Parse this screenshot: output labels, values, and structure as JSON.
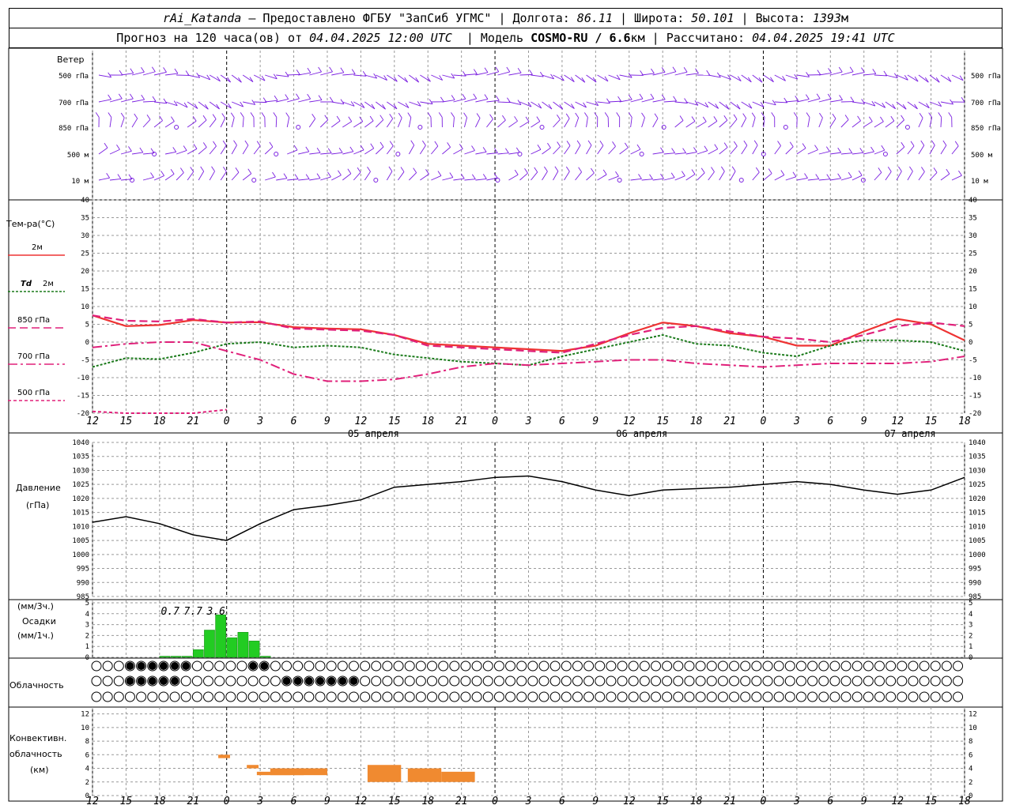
{
  "header": {
    "station": "rAi_Katanda",
    "provider": "— Предоставлено ФГБУ \"ЗапСиб УГМС\"",
    "lon_label": "Долгота:",
    "lon": "86.11",
    "lat_label": "Широта:",
    "lat": "50.101",
    "alt_label": "Высота:",
    "alt": "1393",
    "alt_unit": "м",
    "forecast_prefix": "Прогноз на 120 часа(ов) от",
    "forecast_start": "04.04.2025 12:00 UTC",
    "model_label": "Модель",
    "model": "COSMO-RU / 6.6",
    "model_unit": "км",
    "calc_label": "Рассчитано:",
    "calc_time": "04.04.2025 19:41 UTC"
  },
  "axis": {
    "hours": [
      "12",
      "15",
      "18",
      "21",
      "0",
      "3",
      "6",
      "9",
      "12",
      "15",
      "18",
      "21",
      "0",
      "3",
      "6",
      "9",
      "12",
      "15",
      "18",
      "21",
      "0",
      "3",
      "6",
      "9",
      "12",
      "15",
      "18"
    ],
    "dates": [
      "05 апреля",
      "06 апреля",
      "07 апреля"
    ]
  },
  "labels": {
    "wind": "Ветер",
    "levels": [
      "500 гПа",
      "700 гПа",
      "850 гПа",
      "500 м",
      "10 м"
    ],
    "temp_title": "Тем-ра(°C)",
    "t2m": "2м",
    "td_sym": "Td",
    "td2m": "2м",
    "t850": "850 гПа",
    "t700": "700 гПа",
    "t500": "500 гПа",
    "pressure": "Давление",
    "pressure_unit": "(гПа)",
    "precip_u1": "(мм/3ч.)",
    "precip": "Осадки",
    "precip_u2": "(мм/1ч.)",
    "cloud": "Облачность",
    "conv1": "Конвективн.",
    "conv2": "облачность",
    "conv3": "(км)"
  },
  "colors": {
    "t2m": "#ee3333",
    "td": "#1a7a1a",
    "t850": "#e0207a",
    "wind": "#7a1ee0",
    "precip": "#22cc22",
    "conv": "#f08a30"
  },
  "chart_data": [
    {
      "type": "line",
      "title": "Тем-ра(°C)",
      "ylim": [
        -20,
        40
      ],
      "yticks": [
        -20,
        -15,
        -10,
        -5,
        0,
        5,
        10,
        15,
        20,
        25,
        30,
        35,
        40
      ],
      "x": [
        0,
        1,
        2,
        3,
        4,
        5,
        6,
        7,
        8,
        9,
        10,
        11,
        12,
        13,
        14,
        15,
        16,
        17,
        18,
        19,
        20,
        21,
        22,
        23,
        24,
        25,
        26
      ],
      "series": [
        {
          "name": "2м",
          "values": [
            7.5,
            4.5,
            4.8,
            6.2,
            5.5,
            5.6,
            4.2,
            3.8,
            3.6,
            2.0,
            -0.5,
            -1.0,
            -1.5,
            -2.0,
            -2.5,
            -1.0,
            2.5,
            5.5,
            4.5,
            2.5,
            1.5,
            -1.0,
            -1.0,
            3.0,
            6.5,
            5.0,
            0.5
          ]
        },
        {
          "name": "Td 2м",
          "values": [
            -7,
            -4.5,
            -4.8,
            -3,
            -0.5,
            0,
            -1.5,
            -1,
            -1.5,
            -3.5,
            -4.5,
            -5.5,
            -6,
            -6.5,
            -4,
            -2,
            0,
            2.0,
            -0.5,
            -1,
            -3,
            -4,
            -1,
            0.5,
            0.5,
            0,
            -2.5
          ]
        },
        {
          "name": "850 гПа",
          "values": [
            7.5,
            6.0,
            5.8,
            6.5,
            5.5,
            5.8,
            3.8,
            3.5,
            3.2,
            2.0,
            -1.0,
            -1.5,
            -2.0,
            -2.5,
            -3.0,
            -0.5,
            2.0,
            4.0,
            4.5,
            3.0,
            1.5,
            1.0,
            0.0,
            2.0,
            4.5,
            5.5,
            4.5
          ]
        },
        {
          "name": "700 гПа",
          "values": [
            -1.5,
            -0.5,
            0,
            0,
            -2.5,
            -5,
            -9,
            -11,
            -11,
            -10.5,
            -9,
            -7,
            -6,
            -6.5,
            -6,
            -5.5,
            -5,
            -5,
            -6,
            -6.5,
            -7,
            -6.5,
            -6,
            -6,
            -6,
            -5.5,
            -4
          ]
        },
        {
          "name": "500 гПа",
          "values": [
            -19.5,
            -20,
            -20,
            -20,
            -19
          ]
        }
      ]
    },
    {
      "type": "line",
      "title": "Давление",
      "ylabel": "(гПа)",
      "ylim": [
        985,
        1040
      ],
      "yticks": [
        985,
        990,
        995,
        1000,
        1005,
        1010,
        1015,
        1020,
        1025,
        1030,
        1035,
        1040
      ],
      "x": [
        0,
        1,
        2,
        3,
        4,
        5,
        6,
        7,
        8,
        9,
        10,
        11,
        12,
        13,
        14,
        15,
        16,
        17,
        18,
        19,
        20,
        21,
        22,
        23,
        24,
        25,
        26
      ],
      "values": [
        1011.5,
        1013.5,
        1011,
        1007,
        1005,
        1011,
        1016,
        1017.5,
        1019.5,
        1024,
        1025,
        1026,
        1027.5,
        1028,
        1026,
        1023,
        1021,
        1023,
        1023.5,
        1024,
        1025,
        1026,
        1025,
        1023,
        1021.5,
        1023,
        1027.5
      ]
    },
    {
      "type": "bar",
      "title": "Осадки",
      "ylabel": "(мм/1ч.)",
      "ylim": [
        0,
        5
      ],
      "yticks": [
        0,
        1,
        2,
        3,
        4,
        5
      ],
      "hourly_values": [
        0.1,
        0.1,
        0.1,
        0.7,
        2.5,
        3.9,
        1.8,
        2.3,
        1.5,
        0.1
      ],
      "totals_3h": [
        "0.7",
        "7.7",
        "3.6"
      ]
    },
    {
      "type": "bar",
      "title": "Конвективн. облачность",
      "ylabel": "(км)",
      "ylim": [
        0,
        13
      ],
      "yticks": [
        0,
        2,
        4,
        6,
        8,
        10,
        12
      ],
      "segments": [
        {
          "base": 5.5,
          "top": 6
        },
        {
          "base": 4,
          "top": 4.5
        },
        {
          "base": 3,
          "top": 3.5
        },
        {
          "base": 3,
          "top": 4
        },
        {
          "base": 3,
          "top": 4
        },
        {
          "base": 2,
          "top": 4.5
        },
        {
          "base": 2,
          "top": 4
        },
        {
          "base": 2,
          "top": 3.5
        }
      ]
    }
  ]
}
